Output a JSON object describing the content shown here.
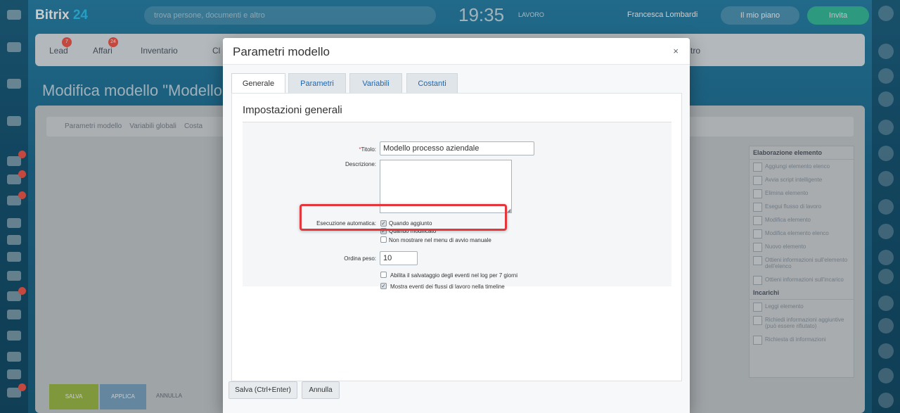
{
  "app": {
    "brand": "Bitrix",
    "brand_num": "24",
    "search_placeholder": "trova persone, documenti e altro",
    "clock": "19:35",
    "work_status": "LAVORO",
    "user_name": "Francesca Lombardi",
    "plan_label": "Il mio piano",
    "invite_label": "Invita"
  },
  "nav": {
    "items": [
      {
        "label": "Lead",
        "badge": "7"
      },
      {
        "label": "Affari",
        "badge": "24"
      },
      {
        "label": "Inventario"
      },
      {
        "label": "Cl"
      },
      {
        "label": "tro"
      }
    ]
  },
  "page": {
    "title": "Modifica modello \"Modello pro",
    "subtabs": [
      "Parametri modello",
      "Variabili globali",
      "Costa"
    ],
    "bottom": {
      "save": "SALVA",
      "apply": "APPLICA",
      "cancel": "ANNULLA"
    }
  },
  "right_panel": {
    "group1": "Elaborazione elemento",
    "items1": [
      "Aggiungi elemento elenco",
      "Avvia script intelligente",
      "Elimina elemento",
      "Esegui flusso di lavoro",
      "Modifica elemento",
      "Modifica elemento elenco",
      "Nuovo elemento",
      "Ottieni informazioni sull'elemento dell'elenco",
      "Ottieni informazioni sull'incarico"
    ],
    "group2": "Incarichi",
    "items2": [
      "Leggi elemento",
      "Richiedi informazioni aggiuntive (può essere rifiutato)",
      "Richiesta di informazioni"
    ]
  },
  "dialog": {
    "title": "Parametri modello",
    "close": "×",
    "tabs": [
      "Generale",
      "Parametri",
      "Variabili",
      "Costanti"
    ],
    "active_tab": "Generale",
    "section_title": "Impostazioni generali",
    "labels": {
      "title": "Titolo:",
      "description": "Descrizione:",
      "auto_exec": "Esecuzione automatica:",
      "weight": "Ordina peso:"
    },
    "values": {
      "title": "Modello processo aziendale",
      "weight": "10"
    },
    "checkboxes": {
      "on_add": "Quando aggiunto",
      "on_modify": "Quando modificato",
      "hide_manual": "Non mostrare nel menu di avvio manuale",
      "log_events": "Abilita il salvataggio degli eventi nel log per 7 giorni",
      "timeline_events": "Mostra eventi dei flussi di lavoro nella timeline"
    },
    "checkbox_states": {
      "on_add": true,
      "on_modify": true,
      "hide_manual": false,
      "log_events": false,
      "timeline_events": true
    },
    "buttons": {
      "save": "Salva (Ctrl+Enter)",
      "cancel": "Annulla"
    }
  }
}
